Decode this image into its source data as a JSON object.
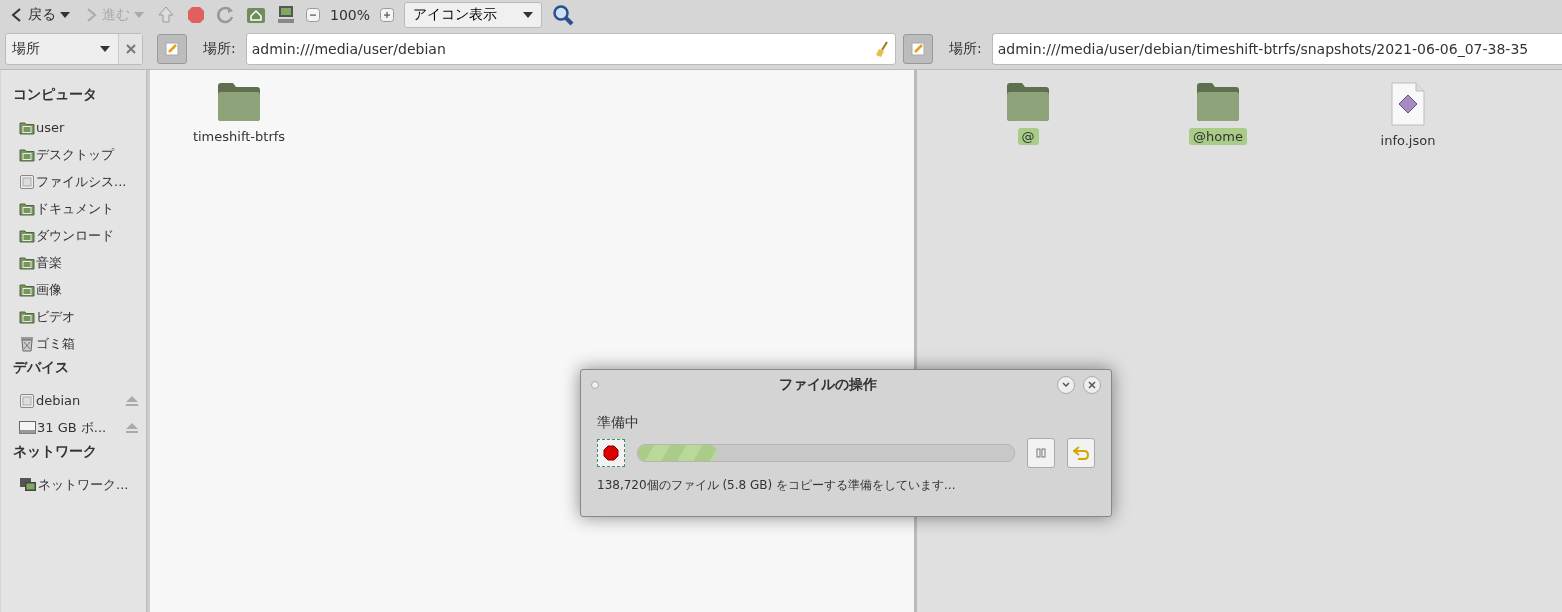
{
  "toolbar": {
    "back": {
      "label": "戻る",
      "disabled": false
    },
    "forward": {
      "label": "進む",
      "disabled": true
    },
    "zoom": "100%",
    "view_mode": "アイコン表示"
  },
  "location_bar": {
    "selector": "場所",
    "left": {
      "label": "場所:",
      "value": "admin:///media/user/debian"
    },
    "right": {
      "label": "場所:",
      "value": "admin:///media/user/debian/timeshift-btrfs/snapshots/2021-06-06_07-38-35"
    }
  },
  "sidebar": {
    "sections": [
      {
        "title": "コンピュータ",
        "items": [
          {
            "label": "user",
            "kind": "folder"
          },
          {
            "label": "デスクトップ",
            "kind": "folder"
          },
          {
            "label": "ファイルシス...",
            "kind": "drive"
          },
          {
            "label": "ドキュメント",
            "kind": "folder"
          },
          {
            "label": "ダウンロード",
            "kind": "folder"
          },
          {
            "label": "音楽",
            "kind": "folder"
          },
          {
            "label": "画像",
            "kind": "folder"
          },
          {
            "label": "ビデオ",
            "kind": "folder"
          },
          {
            "label": "ゴミ箱",
            "kind": "trash"
          }
        ]
      },
      {
        "title": "デバイス",
        "items": [
          {
            "label": "debian",
            "kind": "drive",
            "ejectable": true
          },
          {
            "label": "31 GB ボ...",
            "kind": "usb-drive",
            "ejectable": true
          }
        ]
      },
      {
        "title": "ネットワーク",
        "items": [
          {
            "label": "ネットワーク...",
            "kind": "network"
          }
        ]
      }
    ]
  },
  "left_pane": {
    "files": [
      {
        "name": "timeshift-btrfs",
        "kind": "folder",
        "selected": false
      }
    ]
  },
  "right_pane": {
    "files": [
      {
        "name": "@",
        "kind": "folder",
        "selected": true
      },
      {
        "name": "@home",
        "kind": "folder",
        "selected": true
      },
      {
        "name": "info.json",
        "kind": "document",
        "selected": false
      }
    ]
  },
  "dialog": {
    "title": "ファイルの操作",
    "status": "準備中",
    "level": 0.21,
    "detail": "138,720個のファイル (5.8 GB) をコピーする準備をしています..."
  }
}
